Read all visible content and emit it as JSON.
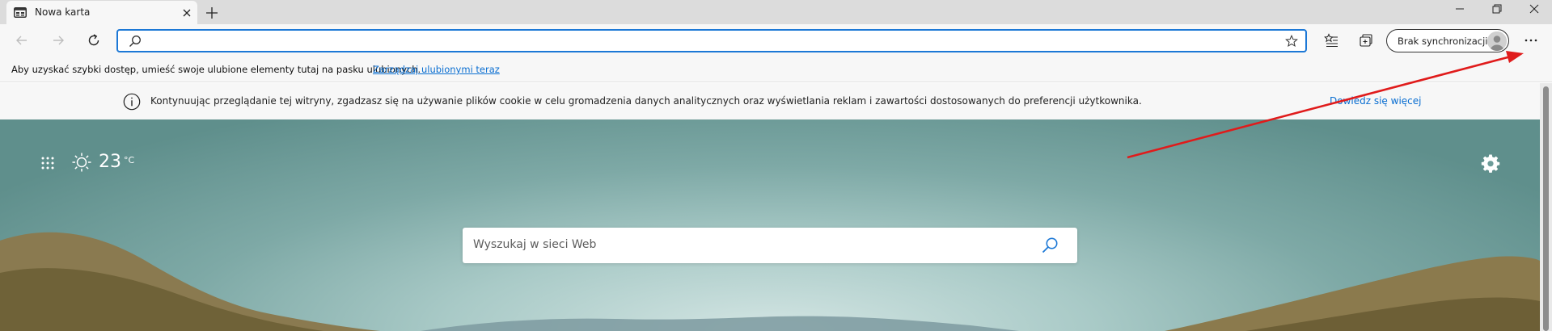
{
  "tab": {
    "title": "Nowa karta"
  },
  "address_bar": {
    "value": "",
    "placeholder": ""
  },
  "sync_button": {
    "label": "Brak synchronizacji"
  },
  "favorites_bar": {
    "message": "Aby uzyskać szybki dostęp, umieść swoje ulubione elementy tutaj na pasku ulubionych.",
    "link": "Zarządzaj ulubionymi teraz"
  },
  "cookie_banner": {
    "text": "Kontynuując przeglądanie tej witryny, zgadzasz się na używanie plików cookie w celu gromadzenia danych analitycznych oraz wyświetlania reklam i zawartości dostosowanych do preferencji użytkownika.",
    "link": "Dowiedz się więcej"
  },
  "weather": {
    "temp": "23",
    "unit": "°C"
  },
  "search": {
    "placeholder": "Wyszukaj w sieci Web"
  },
  "colors": {
    "accent": "#1c78d6",
    "link": "#0a6ed1",
    "annotation": "#e01b1b"
  },
  "icons": {
    "favicon": "newtab-page-icon",
    "close": "close-icon",
    "new_tab": "plus-icon",
    "back": "arrow-left-icon",
    "forward": "arrow-right-icon",
    "refresh": "refresh-icon",
    "search": "search-icon",
    "favorite": "star-icon",
    "favorites": "favorites-list-icon",
    "collections": "collections-icon",
    "avatar": "profile-avatar-icon",
    "more": "more-horizontal-icon",
    "info": "info-icon",
    "apps": "app-launcher-grid-icon",
    "weather": "sun-icon",
    "settings": "gear-icon"
  }
}
